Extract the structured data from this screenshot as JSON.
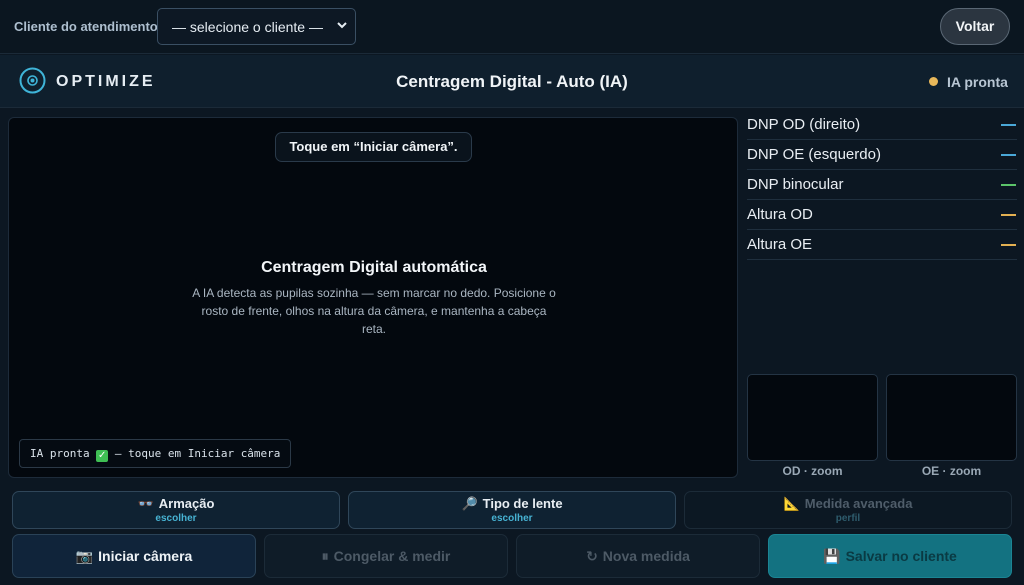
{
  "topbar": {
    "client_label": "Cliente do atendimento:",
    "client_select_value": "— selecione o cliente —",
    "back_label": "Voltar"
  },
  "header": {
    "brand": "OPTIMIZE",
    "title": "Centragem Digital - Auto (IA)",
    "status": "IA pronta",
    "status_color": "#e8b85a"
  },
  "camera": {
    "hint": "Toque em “Iniciar câmera”.",
    "title": "Centragem Digital automática",
    "description": "A IA detecta as pupilas sozinha — sem marcar no dedo. Posicione o rosto de frente, olhos na altura da câmera, e mantenha a cabeça reta.",
    "status_chip_prefix": "IA pronta",
    "status_chip_suffix": "— toque em Iniciar câmera"
  },
  "measures": [
    {
      "label": "DNP OD (direito)",
      "color": "#4aa8d8"
    },
    {
      "label": "DNP OE (esquerdo)",
      "color": "#4aa8d8"
    },
    {
      "label": "DNP binocular",
      "color": "#5cc46a"
    },
    {
      "label": "Altura OD",
      "color": "#e3b052"
    },
    {
      "label": "Altura OE",
      "color": "#e3b052"
    }
  ],
  "zoom": {
    "od_label": "OD · zoom",
    "oe_label": "OE · zoom"
  },
  "options": {
    "frame": {
      "label": "Armação",
      "sub": "escolher",
      "icon": "glasses-icon"
    },
    "lens": {
      "label": "Tipo de lente",
      "sub": "escolher",
      "icon": "magnifier-icon"
    },
    "advanced": {
      "label": "Medida avançada",
      "sub": "perfil",
      "icon": "triangle-ruler-icon"
    }
  },
  "actions": {
    "start_camera": "Iniciar câmera",
    "freeze_measure": "Congelar & medir",
    "new_measure": "Nova medida",
    "save_client": "Salvar no cliente"
  }
}
